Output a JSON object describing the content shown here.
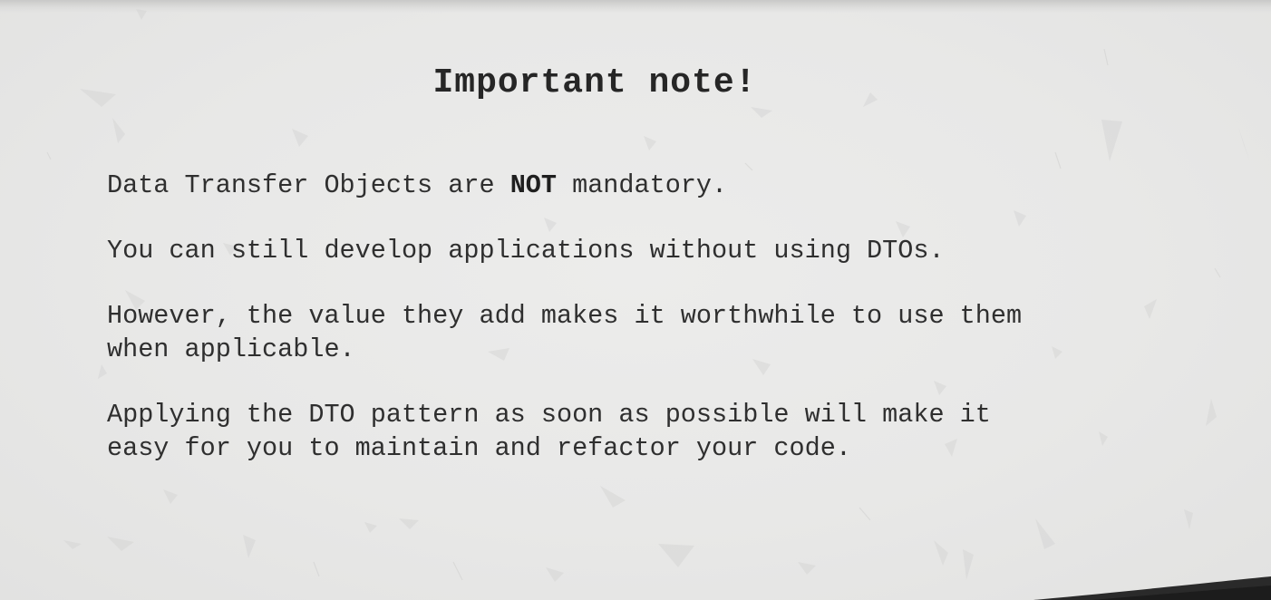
{
  "slide": {
    "title": "Important note!",
    "paragraphs": {
      "p1": {
        "before": "Data Transfer Objects are ",
        "emphasis": "NOT",
        "after": " mandatory."
      },
      "p2": "You can still develop applications without using DTOs.",
      "p3": "However, the value they add makes it worthwhile to use them\nwhen applicable.",
      "p4": "Applying the DTO pattern as soon as possible will make it\neasy for you to maintain and refactor your code."
    }
  },
  "colors": {
    "background": "#e9e9e8",
    "text": "#2f2f2f",
    "title": "#262626",
    "corner": "#2a2a2a"
  }
}
